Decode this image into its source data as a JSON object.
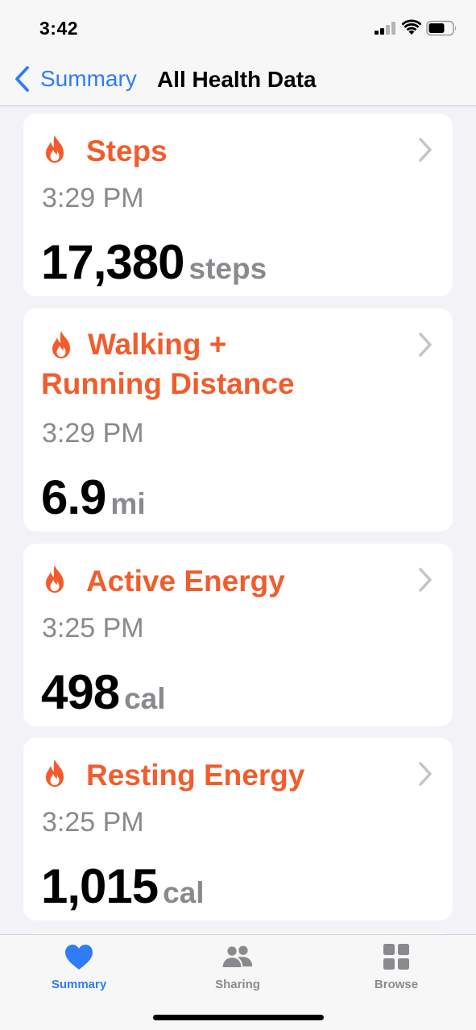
{
  "status_bar": {
    "time": "3:42"
  },
  "nav": {
    "back_label": "Summary",
    "title": "All Health Data"
  },
  "colors": {
    "accent": "#f25c2c",
    "link": "#2f7cf6",
    "secondary_text": "#8a8a8e",
    "background": "#f2f2f7"
  },
  "cards": [
    {
      "title": "Steps",
      "time": "3:29 PM",
      "value": "17,380",
      "unit": "steps",
      "icon": "flame-icon"
    },
    {
      "title_line1": "Walking +",
      "title_line2": "Running Distance",
      "time": "3:29 PM",
      "value": "6.9",
      "unit": "mi",
      "icon": "flame-icon"
    },
    {
      "title": "Active Energy",
      "time": "3:25 PM",
      "value": "498",
      "unit": "cal",
      "icon": "flame-icon"
    },
    {
      "title": "Resting Energy",
      "time": "3:25 PM",
      "value": "1,015",
      "unit": "cal",
      "icon": "flame-icon"
    }
  ],
  "tabs": [
    {
      "label": "Summary",
      "icon": "heart-icon",
      "active": true
    },
    {
      "label": "Sharing",
      "icon": "people-icon",
      "active": false
    },
    {
      "label": "Browse",
      "icon": "grid-icon",
      "active": false
    }
  ]
}
